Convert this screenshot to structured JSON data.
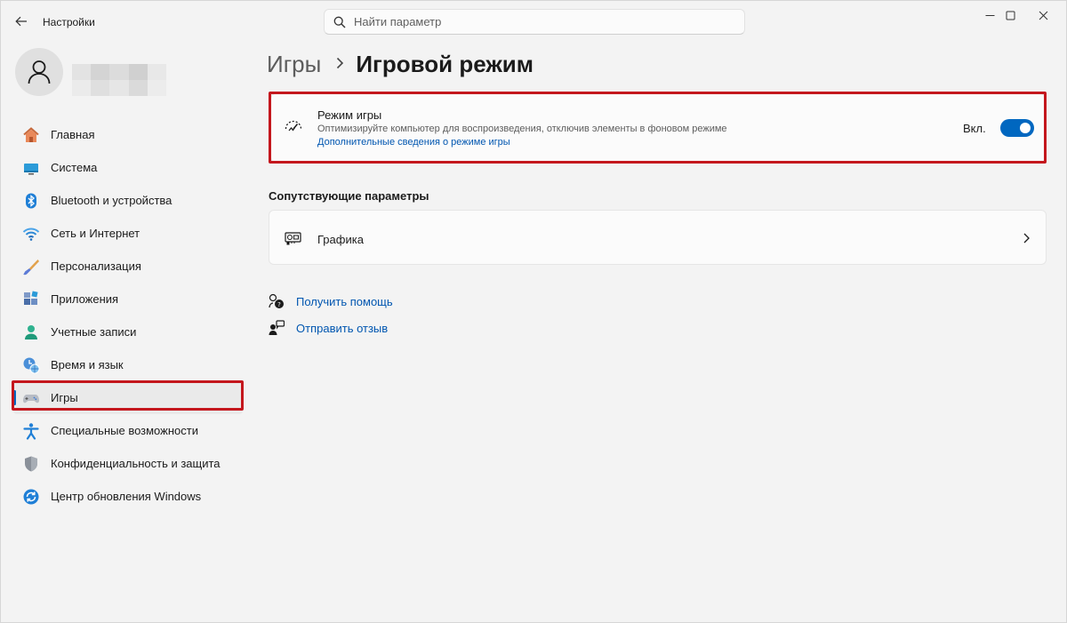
{
  "window": {
    "title": "Настройки",
    "search_placeholder": "Найти параметр"
  },
  "sidebar": {
    "items": [
      {
        "label": "Главная",
        "icon": "home-icon"
      },
      {
        "label": "Система",
        "icon": "monitor-icon"
      },
      {
        "label": "Bluetooth и устройства",
        "icon": "bluetooth-icon"
      },
      {
        "label": "Сеть и Интернет",
        "icon": "wifi-icon"
      },
      {
        "label": "Персонализация",
        "icon": "brush-icon"
      },
      {
        "label": "Приложения",
        "icon": "apps-icon"
      },
      {
        "label": "Учетные записи",
        "icon": "account-icon"
      },
      {
        "label": "Время и язык",
        "icon": "clock-globe-icon"
      },
      {
        "label": "Игры",
        "icon": "gamepad-icon",
        "active": true
      },
      {
        "label": "Специальные возможности",
        "icon": "accessibility-icon"
      },
      {
        "label": "Конфиденциальность и защита",
        "icon": "shield-icon"
      },
      {
        "label": "Центр обновления Windows",
        "icon": "update-icon"
      }
    ]
  },
  "main": {
    "breadcrumb": {
      "parent": "Игры",
      "current": "Игровой режим"
    },
    "game_mode": {
      "title": "Режим игры",
      "description": "Оптимизируйте компьютер для воспроизведения, отключив элементы в фоновом режиме",
      "link": "Дополнительные сведения о режиме игры",
      "toggle_label": "Вкл.",
      "toggle_on": true
    },
    "related_title": "Сопутствующие параметры",
    "graphics_label": "Графика",
    "help": {
      "get_help": "Получить помощь",
      "feedback": "Отправить отзыв"
    }
  },
  "colors": {
    "accent": "#0067c0",
    "highlight": "#c4171d",
    "link": "#0056b0"
  }
}
